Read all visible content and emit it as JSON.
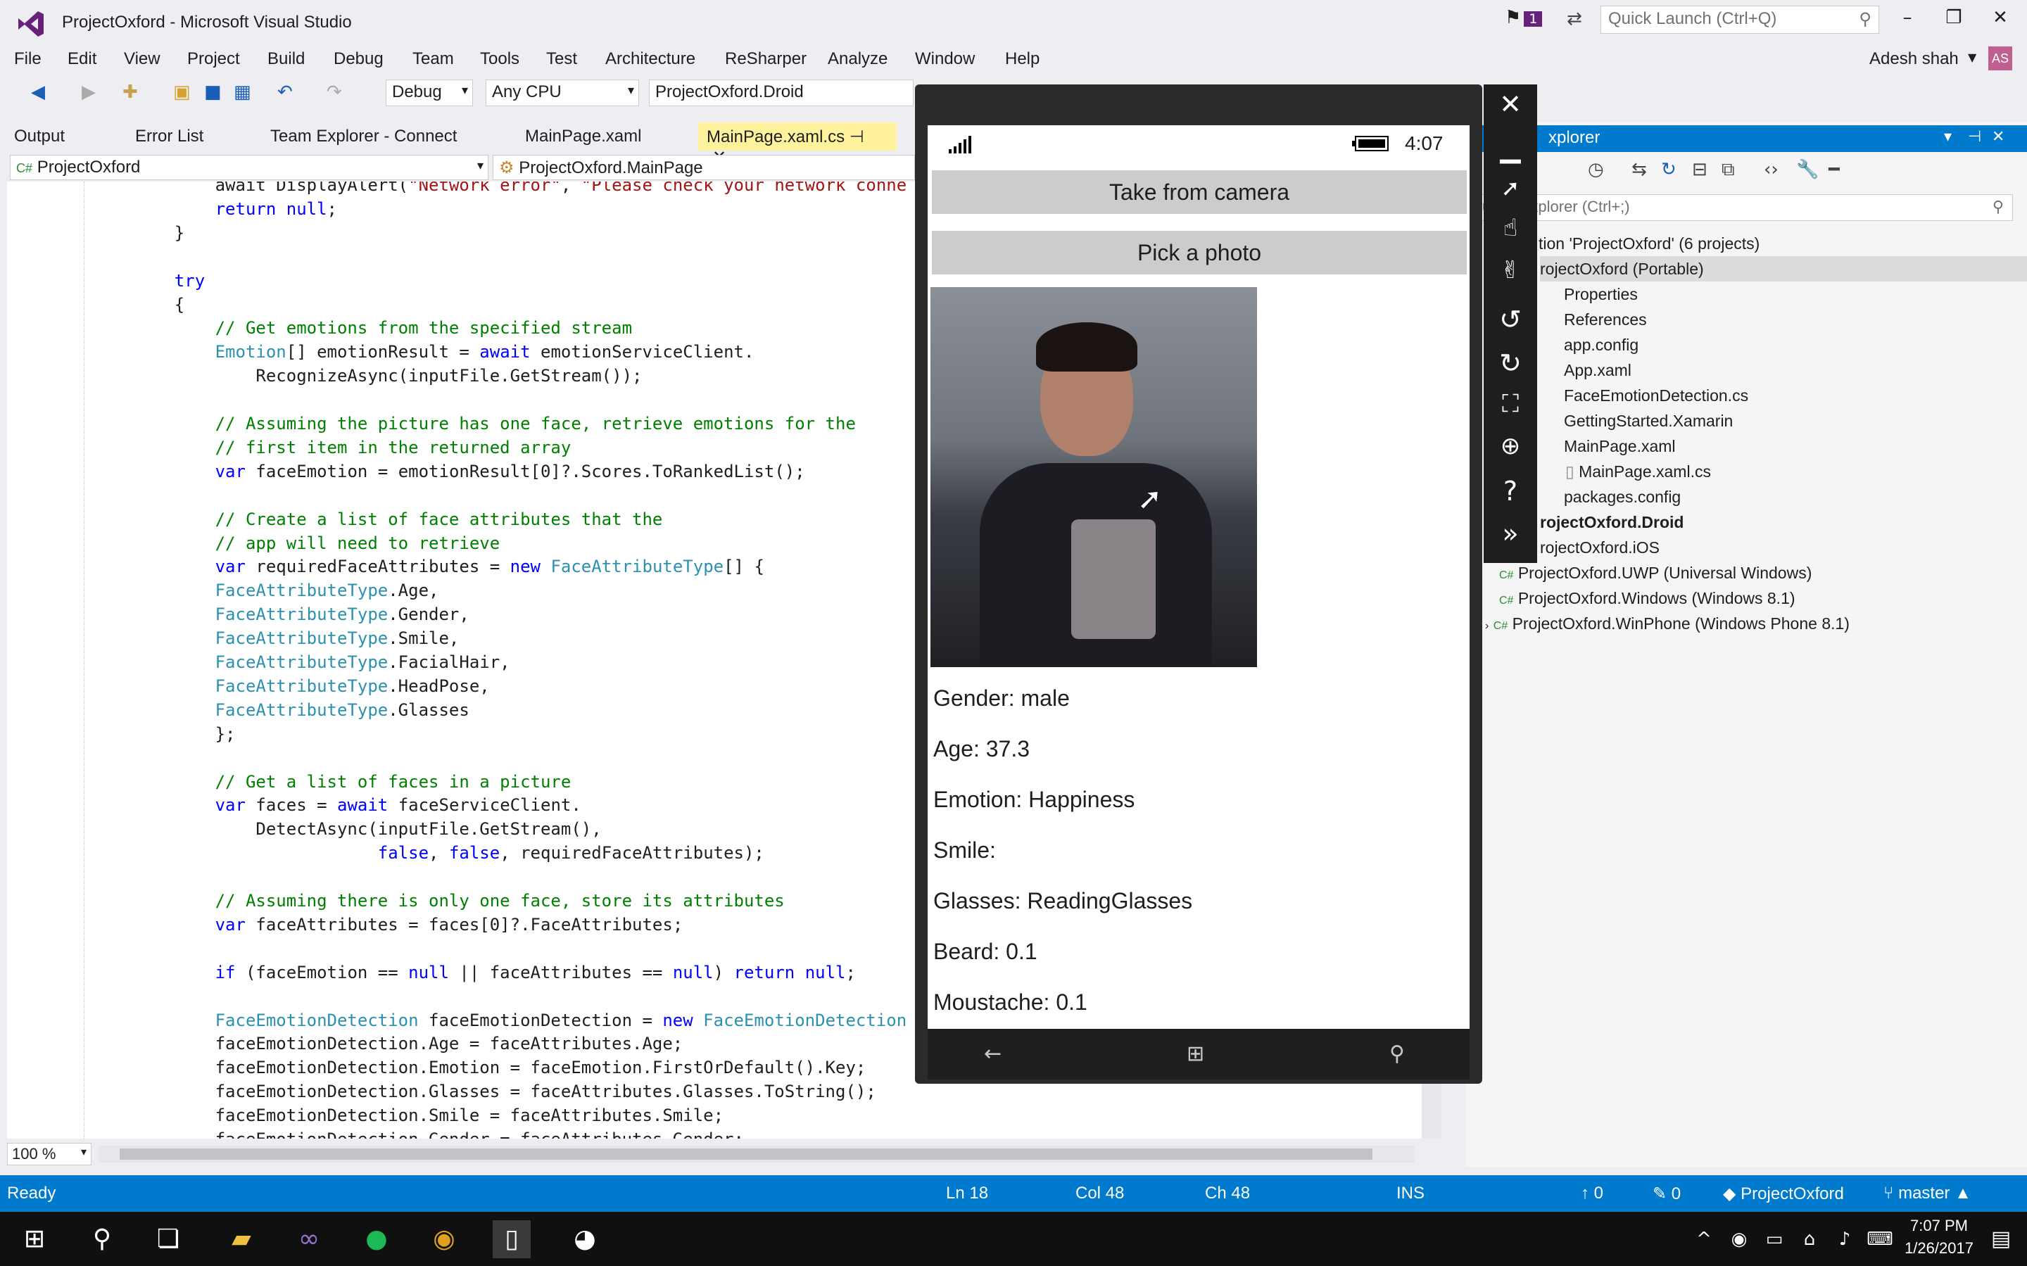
{
  "window": {
    "title": "ProjectOxford - Microsoft Visual Studio",
    "notification_count": "1",
    "quick_launch_placeholder": "Quick Launch (Ctrl+Q)",
    "user": "Adesh shah",
    "avatar_initials": "AS"
  },
  "menu": [
    "File",
    "Edit",
    "View",
    "Project",
    "Build",
    "Debug",
    "Team",
    "Tools",
    "Test",
    "Architecture",
    "ReSharper",
    "Analyze",
    "Window",
    "Help"
  ],
  "toolbar": {
    "configuration": "Debug",
    "platform": "Any CPU",
    "startup_project": "ProjectOxford.Droid"
  },
  "tabs": [
    {
      "label": "Output"
    },
    {
      "label": "Error List"
    },
    {
      "label": "Team Explorer - Connect"
    },
    {
      "label": "MainPage.xaml"
    },
    {
      "label": "MainPage.xaml.cs",
      "active": true
    }
  ],
  "navbar": {
    "project": "ProjectOxford",
    "type": "ProjectOxford.MainPage"
  },
  "code_lines": [
    {
      "indent": 8,
      "parts": [
        [
          "",
          "await DisplayAlert("
        ],
        [
          "st",
          "\"Network error\""
        ],
        [
          "",
          ", "
        ],
        [
          "st",
          "\"Please check your network conne"
        ]
      ]
    },
    {
      "indent": 8,
      "parts": [
        [
          "kw",
          "return"
        ],
        [
          "",
          " "
        ],
        [
          "kw",
          "null"
        ],
        [
          "",
          ";"
        ]
      ]
    },
    {
      "indent": 4,
      "parts": [
        [
          "",
          "}"
        ]
      ]
    },
    {
      "indent": 0,
      "parts": []
    },
    {
      "indent": 4,
      "parts": [
        [
          "kw",
          "try"
        ]
      ]
    },
    {
      "indent": 4,
      "parts": [
        [
          "",
          "{"
        ]
      ]
    },
    {
      "indent": 8,
      "parts": [
        [
          "cm",
          "// Get emotions from the specified stream"
        ]
      ]
    },
    {
      "indent": 8,
      "parts": [
        [
          "ty",
          "Emotion"
        ],
        [
          "",
          "[] emotionResult = "
        ],
        [
          "kw",
          "await"
        ],
        [
          "",
          " emotionServiceClient."
        ]
      ]
    },
    {
      "indent": 12,
      "parts": [
        [
          "",
          "RecognizeAsync(inputFile.GetStream());"
        ]
      ]
    },
    {
      "indent": 0,
      "parts": []
    },
    {
      "indent": 8,
      "parts": [
        [
          "cm",
          "// Assuming the picture has one face, retrieve emotions for the"
        ]
      ]
    },
    {
      "indent": 8,
      "parts": [
        [
          "cm",
          "// first item in the returned array"
        ]
      ]
    },
    {
      "indent": 8,
      "parts": [
        [
          "kw",
          "var"
        ],
        [
          "",
          " faceEmotion = emotionResult[0]?.Scores.ToRankedList();"
        ]
      ]
    },
    {
      "indent": 0,
      "parts": []
    },
    {
      "indent": 8,
      "parts": [
        [
          "cm",
          "// Create a list of face attributes that the"
        ]
      ]
    },
    {
      "indent": 8,
      "parts": [
        [
          "cm",
          "// app will need to retrieve"
        ]
      ]
    },
    {
      "indent": 8,
      "parts": [
        [
          "kw",
          "var"
        ],
        [
          "",
          " requiredFaceAttributes = "
        ],
        [
          "kw",
          "new"
        ],
        [
          "",
          " "
        ],
        [
          "ty",
          "FaceAttributeType"
        ],
        [
          "",
          "[] {"
        ]
      ]
    },
    {
      "indent": 8,
      "parts": [
        [
          "ty",
          "FaceAttributeType"
        ],
        [
          "",
          ".Age,"
        ]
      ]
    },
    {
      "indent": 8,
      "parts": [
        [
          "ty",
          "FaceAttributeType"
        ],
        [
          "",
          ".Gender,"
        ]
      ]
    },
    {
      "indent": 8,
      "parts": [
        [
          "ty",
          "FaceAttributeType"
        ],
        [
          "",
          ".Smile,"
        ]
      ]
    },
    {
      "indent": 8,
      "parts": [
        [
          "ty",
          "FaceAttributeType"
        ],
        [
          "",
          ".FacialHair,"
        ]
      ]
    },
    {
      "indent": 8,
      "parts": [
        [
          "ty",
          "FaceAttributeType"
        ],
        [
          "",
          ".HeadPose,"
        ]
      ]
    },
    {
      "indent": 8,
      "parts": [
        [
          "ty",
          "FaceAttributeType"
        ],
        [
          "",
          ".Glasses"
        ]
      ]
    },
    {
      "indent": 8,
      "parts": [
        [
          "",
          "};"
        ]
      ]
    },
    {
      "indent": 0,
      "parts": []
    },
    {
      "indent": 8,
      "parts": [
        [
          "cm",
          "// Get a list of faces in a picture"
        ]
      ]
    },
    {
      "indent": 8,
      "parts": [
        [
          "kw",
          "var"
        ],
        [
          "",
          " faces = "
        ],
        [
          "kw",
          "await"
        ],
        [
          "",
          " faceServiceClient."
        ]
      ]
    },
    {
      "indent": 12,
      "parts": [
        [
          "",
          "DetectAsync(inputFile.GetStream(),"
        ]
      ]
    },
    {
      "indent": 24,
      "parts": [
        [
          "kw",
          "false"
        ],
        [
          "",
          ", "
        ],
        [
          "kw",
          "false"
        ],
        [
          "",
          ", requiredFaceAttributes);"
        ]
      ]
    },
    {
      "indent": 0,
      "parts": []
    },
    {
      "indent": 8,
      "parts": [
        [
          "cm",
          "// Assuming there is only one face, store its attributes"
        ]
      ]
    },
    {
      "indent": 8,
      "parts": [
        [
          "kw",
          "var"
        ],
        [
          "",
          " faceAttributes = faces[0]?.FaceAttributes;"
        ]
      ]
    },
    {
      "indent": 0,
      "parts": []
    },
    {
      "indent": 8,
      "parts": [
        [
          "kw",
          "if"
        ],
        [
          "",
          " (faceEmotion == "
        ],
        [
          "kw",
          "null"
        ],
        [
          "",
          " || faceAttributes == "
        ],
        [
          "kw",
          "null"
        ],
        [
          "",
          ") "
        ],
        [
          "kw",
          "return"
        ],
        [
          "",
          " "
        ],
        [
          "kw",
          "null"
        ],
        [
          "",
          ";"
        ]
      ]
    },
    {
      "indent": 0,
      "parts": []
    },
    {
      "indent": 8,
      "parts": [
        [
          "ty",
          "FaceEmotionDetection"
        ],
        [
          "",
          " faceEmotionDetection = "
        ],
        [
          "kw",
          "new"
        ],
        [
          "",
          " "
        ],
        [
          "ty",
          "FaceEmotionDetection"
        ]
      ]
    },
    {
      "indent": 8,
      "parts": [
        [
          "",
          "faceEmotionDetection.Age = faceAttributes.Age;"
        ]
      ]
    },
    {
      "indent": 8,
      "parts": [
        [
          "",
          "faceEmotionDetection.Emotion = faceEmotion.FirstOrDefault().Key;"
        ]
      ]
    },
    {
      "indent": 8,
      "parts": [
        [
          "",
          "faceEmotionDetection.Glasses = faceAttributes.Glasses.ToString();"
        ]
      ]
    },
    {
      "indent": 8,
      "parts": [
        [
          "",
          "faceEmotionDetection.Smile = faceAttributes.Smile;"
        ]
      ]
    },
    {
      "indent": 8,
      "parts": [
        [
          "",
          "faceEmotionDetection.Gender = faceAttributes.Gender;"
        ]
      ]
    }
  ],
  "editor": {
    "zoom": "100 %"
  },
  "solution_explorer": {
    "title": "Solution Explorer",
    "visible_title": "xplorer",
    "search_placeholder": "lution Explorer (Ctrl+;)",
    "items": [
      {
        "label": "tion 'ProjectOxford' (6 projects)",
        "level": 0,
        "bold": false,
        "selected": false
      },
      {
        "label": "rojectOxford (Portable)",
        "level": 0,
        "bold": false,
        "selected": true
      },
      {
        "label": "Properties",
        "level": 1
      },
      {
        "label": "References",
        "level": 1
      },
      {
        "label": "app.config",
        "level": 1
      },
      {
        "label": "App.xaml",
        "level": 1
      },
      {
        "label": "FaceEmotionDetection.cs",
        "level": 1
      },
      {
        "label": "GettingStarted.Xamarin",
        "level": 1
      },
      {
        "label": "MainPage.xaml",
        "level": 1
      },
      {
        "label": "MainPage.xaml.cs",
        "level": 2
      },
      {
        "label": "packages.config",
        "level": 1
      },
      {
        "label": "rojectOxford.Droid",
        "level": 0,
        "bold": true
      },
      {
        "label": "rojectOxford.iOS",
        "level": 0
      },
      {
        "label": "ProjectOxford.UWP (Universal Windows)",
        "level": 0
      },
      {
        "label": "ProjectOxford.Windows (Windows 8.1)",
        "level": 0
      },
      {
        "label": "ProjectOxford.WinPhone (Windows Phone 8.1)",
        "level": 0
      }
    ]
  },
  "emulator": {
    "time": "4:07",
    "buttons": [
      "Take from camera",
      "Pick a photo"
    ],
    "results": [
      {
        "label": "Gender:",
        "value": "male"
      },
      {
        "label": "Age:",
        "value": "37.3"
      },
      {
        "label": "Emotion:",
        "value": "Happiness"
      },
      {
        "label": "Smile:",
        "value": ""
      },
      {
        "label": "Glasses:",
        "value": "ReadingGlasses"
      },
      {
        "label": "Beard:",
        "value": "0.1"
      },
      {
        "label": "Moustache:",
        "value": "0.1"
      }
    ]
  },
  "statusbar": {
    "state": "Ready",
    "ln": "Ln 18",
    "col": "Col 48",
    "ch": "Ch 48",
    "mode": "INS",
    "pushes": "0",
    "edits": "0",
    "repo": "ProjectOxford",
    "branch": "master"
  },
  "taskbar": {
    "time": "7:07 PM",
    "date": "1/26/2017",
    "apps": [
      "start-icon",
      "search-icon",
      "task-view-icon",
      "file-explorer-icon",
      "visual-studio-icon",
      "spotify-icon",
      "chrome-icon",
      "phone-emulator-icon",
      "github-icon"
    ]
  },
  "colors": {
    "accent": "#007acc",
    "active_tab": "#fff29d",
    "keyword": "#0000ff",
    "type": "#2b91af",
    "comment": "#008000",
    "string": "#a31515"
  }
}
